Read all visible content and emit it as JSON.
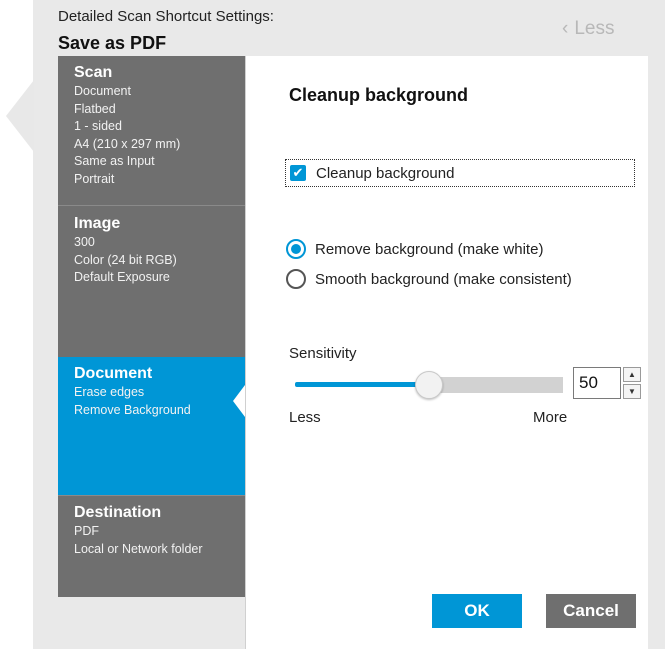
{
  "header": {
    "caption": "Detailed Scan Shortcut Settings:",
    "title": "Save as PDF",
    "less_label": "Less",
    "less_icon": "chevron-left-icon"
  },
  "sidebar": {
    "sections": [
      {
        "title": "Scan",
        "items": [
          "Document",
          "Flatbed",
          "1 - sided",
          "A4 (210 x 297 mm)",
          "Same as Input",
          "Portrait"
        ]
      },
      {
        "title": "Image",
        "items": [
          "300",
          "Color (24 bit RGB)",
          "Default Exposure"
        ]
      },
      {
        "title": "Document",
        "items": [
          "Erase edges",
          "Remove Background"
        ],
        "active": true
      },
      {
        "title": "Destination",
        "items": [
          "PDF",
          "Local or Network folder"
        ]
      }
    ]
  },
  "panel": {
    "title": "Cleanup background",
    "checkbox": {
      "label": "Cleanup background",
      "checked": true
    },
    "radios": [
      {
        "label": "Remove background (make white)",
        "selected": true
      },
      {
        "label": "Smooth background (make consistent)",
        "selected": false
      }
    ],
    "sensitivity": {
      "label": "Sensitivity",
      "value": "50",
      "fraction": 0.5,
      "min_label": "Less",
      "max_label": "More"
    },
    "ok_label": "OK",
    "cancel_label": "Cancel"
  },
  "colors": {
    "accent": "#0096d6",
    "sidebar_bg": "#6f6f6f",
    "frame_bg": "#e9e9e9"
  }
}
